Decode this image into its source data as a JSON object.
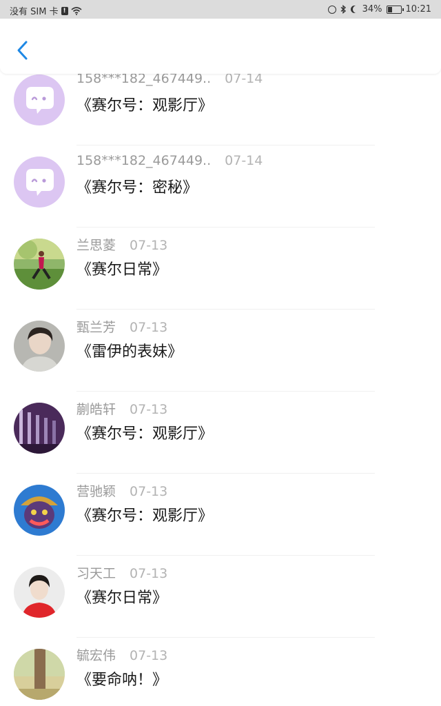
{
  "status_bar": {
    "carrier": "没有 SIM 卡",
    "sim_badge": "!",
    "battery_percent": "34%",
    "battery_level": 0.34,
    "time": "10:21"
  },
  "header": {
    "back_icon": "chevron-left-icon",
    "accent_color": "#1e88e5"
  },
  "items": [
    {
      "name": "158***182_467449..",
      "date": "07-14",
      "title": "《赛尔号：观影厅》",
      "avatar": "chat-bot-icon"
    },
    {
      "name": "158***182_467449..",
      "date": "07-14",
      "title": "《赛尔号：密秘》",
      "avatar": "chat-bot-icon"
    },
    {
      "name": "兰思菱",
      "date": "07-13",
      "title": "《赛尔日常》",
      "avatar": "photo-park-person"
    },
    {
      "name": "甄兰芳",
      "date": "07-13",
      "title": "《雷伊的表妹》",
      "avatar": "photo-boy-portrait"
    },
    {
      "name": "蒯皓轩",
      "date": "07-13",
      "title": "《赛尔号：观影厅》",
      "avatar": "photo-purple-pillars"
    },
    {
      "name": "营驰颖",
      "date": "07-13",
      "title": "《赛尔号：观影厅》",
      "avatar": "photo-cartoon-monster"
    },
    {
      "name": "习天工",
      "date": "07-13",
      "title": "《赛尔日常》",
      "avatar": "photo-boy-red-shirt"
    },
    {
      "name": "毓宏伟",
      "date": "07-13",
      "title": "《要命呐！》",
      "avatar": "photo-tree-trunk"
    }
  ]
}
